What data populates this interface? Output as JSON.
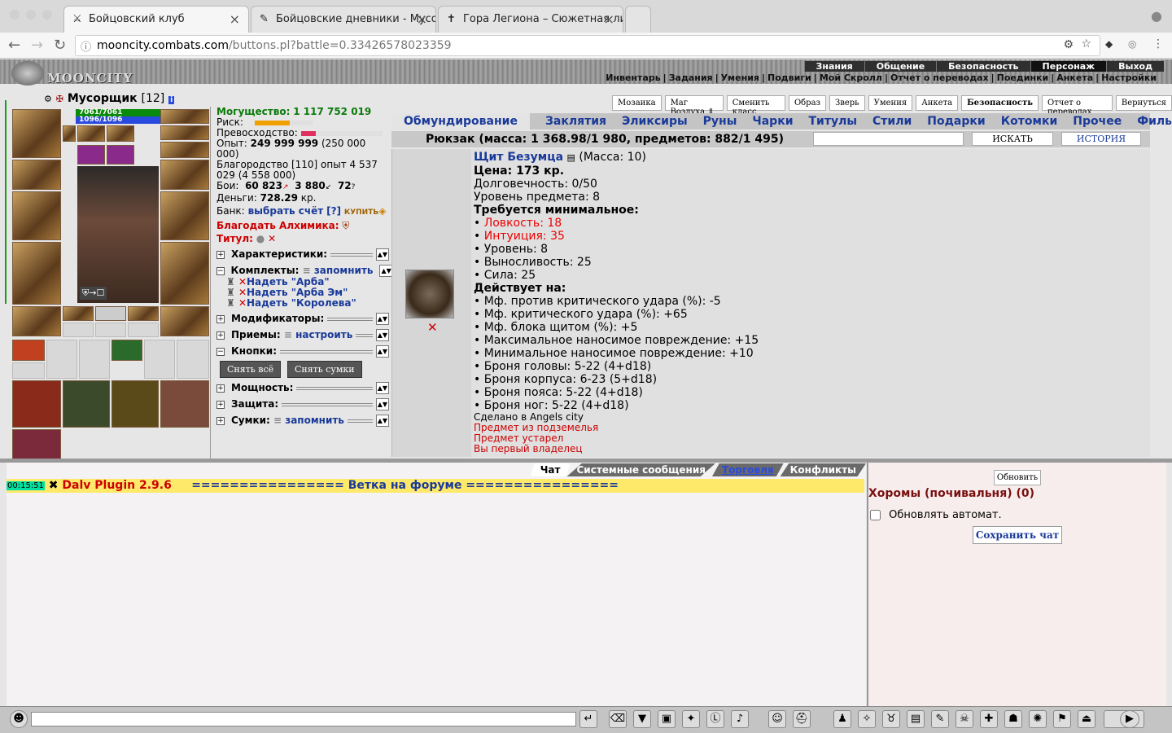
{
  "browser": {
    "tabs": [
      {
        "label": "Бойцовский клуб",
        "icon": "⚔"
      },
      {
        "label": "Бойцовские дневники - Мусо",
        "icon": "✎"
      },
      {
        "label": "Гора Легиона – Сюжетная ли",
        "icon": "✝"
      }
    ],
    "url_host": "mooncity.combats.com",
    "url_path": "/buttons.pl?battle=0.33426578023359"
  },
  "top_menu": [
    "Знания",
    "Общение",
    "Безопасность",
    "Персонаж",
    "Выход"
  ],
  "sub_menu": [
    "Инвентарь",
    "Задания",
    "Умения",
    "Подвиги",
    "Мой Скролл",
    "Отчет о переводах",
    "Поединки",
    "Анкета",
    "Настройки"
  ],
  "logo": "MOONCITY",
  "character": {
    "name": "Мусорщик",
    "level": "[12]",
    "hp": "7061/7061",
    "mp": "1096/1096"
  },
  "stats": {
    "power_label": "Могущество:",
    "power_value": "1 117 752 019",
    "risk_label": "Риск:",
    "superiority_label": "Превосходство:",
    "exp_label": "Опыт:",
    "exp_value": "249 999 999",
    "exp_extra": "(250 000 000)",
    "nobility": "Благородство [110] опыт 4 537 029 (4 558 000)",
    "fights_label": "Бои:",
    "fights_wins": "60 823",
    "fights_losses": "3 880",
    "fights_draws": "72",
    "money_label": "Деньги:",
    "money_value": "728.29",
    "money_unit": "кр.",
    "bank_label": "Банк:",
    "bank_link": "выбрать счёт",
    "bank_help": "[?]",
    "bank_buy": "КУПИТЬ",
    "alchemist": "Благодать Алхимика:",
    "title_label": "Титул:"
  },
  "sections": {
    "characteristics": "Характеристики:",
    "sets": "Комплекты:",
    "sets_remember": "запомнить",
    "set_items": [
      "Надеть \"Арба\"",
      "Надеть \"Арба Эм\"",
      "Надеть \"Королева\""
    ],
    "modifiers": "Модификаторы:",
    "techniques": "Приемы:",
    "techniques_link": "настроить",
    "buttons": "Кнопки:",
    "remove_all": "Снять всё",
    "remove_bags": "Снять сумки",
    "power": "Мощность:",
    "defense": "Защита:",
    "bags": "Сумки:",
    "bags_remember": "запомнить"
  },
  "nav_buttons": [
    "Мозаика",
    "Маг Воздуха",
    "Сменить класс",
    "Образ",
    "Зверь",
    "Умения",
    "Анкета",
    "Безопасность",
    "Отчет о переводах",
    "Вернуться"
  ],
  "inventory_tabs": [
    "Обмундирование",
    "Заклятия",
    "Эликсиры",
    "Руны",
    "Чарки",
    "Титулы",
    "Стили",
    "Подарки",
    "Котомки",
    "Прочее",
    "Фильтр"
  ],
  "backpack": {
    "title": "Рюкзак (масса: 1 368.98/1 980, предметов: 882/1 495)",
    "search_button": "ИСКАТЬ",
    "history_button": "ИСТОРИЯ"
  },
  "item": {
    "name": "Щит Безумца",
    "mass": "(Масса: 10)",
    "price": "Цена: 173 кр.",
    "durability": "Долговечность: 0/50",
    "item_level": "Уровень предмета: 8",
    "requires_label": "Требуется минимальное:",
    "requirements": [
      {
        "text": "Ловкость: 18",
        "unmet": true
      },
      {
        "text": "Интуиция: 35",
        "unmet": true
      },
      {
        "text": "Уровень: 8",
        "unmet": false
      },
      {
        "text": "Выносливость: 25",
        "unmet": false
      },
      {
        "text": "Сила: 25",
        "unmet": false
      }
    ],
    "effects_label": "Действует на:",
    "effects": [
      "Мф. против критического удара (%): -5",
      "Мф. критического удара (%): +65",
      "Мф. блока щитом (%): +5",
      "Максимальное наносимое повреждение: +15",
      "Минимальное наносимое повреждение: +10",
      "Броня головы: 5-22 (4+d18)",
      "Броня корпуса: 6-23 (5+d18)",
      "Броня пояса: 5-22 (4+d18)",
      "Броня ног: 5-22 (4+d18)"
    ],
    "made_in": "Сделано в Angels city",
    "notes": [
      "Предмет из подземелья",
      "Предмет устарел",
      "Вы первый владелец"
    ]
  },
  "chat": {
    "tabs": [
      "Чат",
      "Системные сообщения",
      "Торговля",
      "Конфликты"
    ],
    "time": "00:15:51",
    "plugin": "Dalv Plugin 2.9.6",
    "forum": "================ Ветка на форуме ================"
  },
  "room": {
    "refresh": "Обновить",
    "title": "Хоромы (почивальня) (0)",
    "auto_update": "Обновлять автомат.",
    "save_chat": "Сохранить чат"
  }
}
